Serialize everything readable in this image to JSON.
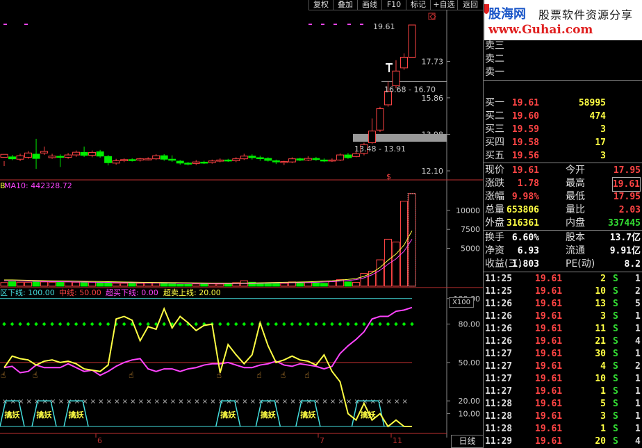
{
  "toolbar": {
    "b1": "复权",
    "b2": "叠加",
    "b3": "画线",
    "b4": "F10",
    "b5": "标记",
    "b6": "+自选",
    "b7": "返回"
  },
  "logo": {
    "brand": "股海网",
    "slogan": "股票软件资源分享",
    "url": "www.Guhai.com"
  },
  "chart_data": [
    {
      "type": "candlestick",
      "title": "",
      "ylim": [
        12.1,
        19.61
      ],
      "yticks": [
        12.1,
        13.98,
        15.86,
        17.73
      ],
      "annotations": [
        "19.61",
        "16.68 - 16.70",
        "13.48 - 13.91",
        "$"
      ],
      "candles": [
        [
          12.8,
          12.95,
          12.6,
          12.35
        ],
        [
          12.82,
          12.72,
          12.92,
          12.65
        ],
        [
          12.7,
          12.88,
          12.98,
          12.6
        ],
        [
          12.8,
          13.02,
          13.12,
          12.72
        ],
        [
          12.96,
          12.74,
          13.75,
          12.2
        ],
        [
          13.02,
          13.1,
          13.35,
          12.92
        ],
        [
          12.78,
          12.86,
          12.98,
          12.72
        ],
        [
          12.85,
          12.82,
          12.95,
          12.3
        ],
        [
          12.8,
          12.92,
          13.02,
          12.72
        ],
        [
          12.92,
          13.06,
          13.15,
          12.82
        ],
        [
          13.05,
          12.9,
          13.35,
          12.82
        ],
        [
          12.9,
          13.05,
          13.15,
          12.8
        ],
        [
          13.08,
          12.86,
          13.18,
          12.78
        ],
        [
          12.84,
          12.52,
          12.92,
          12.38
        ],
        [
          12.5,
          12.62,
          12.72,
          12.42
        ],
        [
          12.62,
          12.68,
          12.75,
          12.55
        ],
        [
          12.68,
          12.64,
          12.75,
          12.58
        ],
        [
          12.66,
          12.72,
          12.78,
          12.58
        ],
        [
          12.72,
          12.72,
          12.8,
          12.64
        ],
        [
          12.72,
          12.88,
          12.96,
          12.66
        ],
        [
          12.88,
          12.7,
          12.96,
          12.62
        ],
        [
          12.7,
          12.65,
          12.9,
          12.56
        ],
        [
          12.6,
          12.5,
          12.66,
          12.42
        ],
        [
          12.5,
          12.46,
          12.56,
          12.38
        ],
        [
          12.48,
          12.56,
          12.66,
          12.4
        ],
        [
          12.55,
          12.52,
          12.62,
          12.45
        ],
        [
          12.53,
          12.61,
          12.68,
          12.47
        ],
        [
          12.6,
          12.66,
          12.74,
          12.54
        ],
        [
          12.66,
          12.62,
          12.72,
          12.56
        ],
        [
          12.62,
          12.72,
          12.8,
          12.55
        ],
        [
          12.72,
          12.86,
          12.98,
          12.66
        ],
        [
          12.86,
          12.78,
          12.95,
          12.68
        ],
        [
          12.78,
          12.75,
          12.88,
          12.62
        ],
        [
          12.74,
          12.64,
          12.8,
          12.58
        ],
        [
          12.62,
          12.56,
          12.68,
          12.45
        ],
        [
          12.55,
          12.58,
          12.62,
          12.4
        ],
        [
          12.56,
          12.72,
          12.8,
          12.5
        ],
        [
          12.72,
          12.65,
          12.78,
          12.6
        ],
        [
          12.66,
          12.74,
          12.86,
          12.6
        ],
        [
          12.74,
          12.68,
          12.82,
          12.62
        ],
        [
          12.66,
          12.62,
          12.74,
          12.55
        ],
        [
          12.62,
          12.66,
          12.74,
          12.56
        ],
        [
          12.66,
          12.92,
          13.0,
          12.6
        ],
        [
          12.92,
          12.78,
          13.02,
          12.72
        ],
        [
          12.84,
          12.98,
          13.12,
          12.8
        ],
        [
          13.0,
          13.45,
          13.55,
          12.9
        ],
        [
          13.55,
          14.15,
          14.8,
          13.48
        ],
        [
          14.2,
          15.3,
          15.4,
          14.1
        ],
        [
          15.5,
          16.2,
          16.7,
          15.4
        ],
        [
          16.48,
          17.24,
          17.8,
          16.35
        ],
        [
          17.4,
          17.95,
          18.15,
          17.3
        ],
        [
          17.95,
          19.61,
          19.61,
          17.95
        ]
      ]
    },
    {
      "type": "bar",
      "title": "MA10: 442328.72",
      "ylim": [
        0,
        12200
      ],
      "yticks": [
        5000,
        7500,
        10000
      ],
      "unit": "X100",
      "values": [
        480,
        580,
        520,
        520,
        620,
        560,
        520,
        500,
        560,
        520,
        560,
        520,
        460,
        440,
        380,
        380,
        380,
        380,
        400,
        400,
        360,
        300,
        240,
        240,
        300,
        320,
        300,
        280,
        300,
        460,
        720,
        520,
        420,
        400,
        360,
        380,
        560,
        480,
        460,
        420,
        380,
        620,
        860,
        560,
        500,
        1700,
        1980,
        3480,
        6200,
        5840,
        11220,
        12220
      ],
      "ma10": [
        700,
        700,
        680,
        660,
        640,
        620,
        600,
        590,
        580,
        560,
        545,
        530,
        520,
        510,
        490,
        470,
        460,
        440,
        430,
        420,
        410,
        400,
        390,
        380,
        370,
        360,
        350,
        345,
        340,
        340,
        350,
        360,
        380,
        400,
        420,
        440,
        450,
        470,
        490,
        520,
        560,
        600,
        680,
        760,
        860,
        1100,
        1500,
        2100,
        2900,
        3600,
        4600,
        6200
      ]
    },
    {
      "type": "line",
      "title": "",
      "legend": [
        "区下线: 100.00",
        "中线: 50.00",
        "超买下线: 0.00",
        "超卖上线: 20.00"
      ],
      "ylim": [
        0,
        100
      ],
      "yticks": [
        10.0,
        20.0,
        50.0,
        80.0,
        100.0
      ],
      "hlines": [
        100,
        50,
        20
      ],
      "dotted_level": 80.0,
      "marker_label": "擒妖",
      "date_labels": [
        "6",
        "7",
        "11"
      ],
      "magenta": [
        46,
        47,
        42,
        43,
        48,
        46,
        46,
        46,
        49,
        46,
        43,
        44,
        40,
        43,
        47,
        50,
        52,
        53,
        45,
        43,
        45,
        45,
        43,
        45,
        46,
        48,
        49,
        49,
        50,
        48,
        46,
        46,
        48,
        49,
        51,
        48,
        47,
        49,
        48,
        47,
        45,
        47,
        57,
        63,
        68,
        74,
        84,
        86,
        86,
        90,
        91,
        93
      ],
      "yellow": [
        46,
        55,
        53,
        52,
        48,
        51,
        52,
        50,
        51,
        49,
        45,
        44,
        43,
        48,
        84,
        86,
        83,
        67,
        78,
        76,
        92,
        77,
        86,
        81,
        75,
        79,
        80,
        42,
        64,
        56,
        49,
        56,
        81,
        63,
        50,
        52,
        55,
        52,
        51,
        48,
        56,
        43,
        35,
        10,
        5,
        18,
        5,
        10,
        0,
        5,
        0,
        0
      ]
    }
  ],
  "quote": {
    "sell": [
      {
        "l": "卖五"
      },
      {
        "l": "卖四"
      },
      {
        "l": "卖三"
      },
      {
        "l": "卖二"
      },
      {
        "l": "卖一"
      }
    ],
    "buy": [
      {
        "l": "买一",
        "p": "19.61",
        "v": "58995"
      },
      {
        "l": "买二",
        "p": "19.60",
        "v": "474"
      },
      {
        "l": "买三",
        "p": "19.59",
        "v": "3"
      },
      {
        "l": "买四",
        "p": "19.58",
        "v": "17"
      },
      {
        "l": "买五",
        "p": "19.56",
        "v": "3"
      }
    ],
    "stats": [
      {
        "l": "现价",
        "a": "19.61",
        "l2": "今开",
        "b": "17.95"
      },
      {
        "l": "涨跌",
        "a": "1.78",
        "l2": "最高",
        "b": "19.61"
      },
      {
        "l": "涨幅",
        "a": "9.98%",
        "l2": "最低",
        "b": "17.95"
      },
      {
        "l": "总量",
        "a": "653806",
        "l2": "量比",
        "b": "2.03"
      },
      {
        "l": "外盘",
        "a": "316361",
        "l2": "内盘",
        "b": "337445"
      }
    ],
    "fin": [
      {
        "l": "换手",
        "a": "6.60%",
        "l2": "股本",
        "b": "13.7亿"
      },
      {
        "l": "净资",
        "a": "6.93",
        "l2": "流通",
        "b": "9.91亿"
      },
      {
        "l": "收益(三)",
        "a": "1.803",
        "l2": "PE(动)",
        "b": "8.2"
      }
    ]
  },
  "ticks": [
    {
      "t": "11:25",
      "p": "19.61",
      "v": "2",
      "s": "S",
      "n": "1"
    },
    {
      "t": "11:25",
      "p": "19.61",
      "v": "10",
      "s": "S",
      "n": "2"
    },
    {
      "t": "11:26",
      "p": "19.61",
      "v": "13",
      "s": "S",
      "n": "5"
    },
    {
      "t": "11:26",
      "p": "19.61",
      "v": "3",
      "s": "S",
      "n": "1"
    },
    {
      "t": "11:26",
      "p": "19.61",
      "v": "11",
      "s": "S",
      "n": "1"
    },
    {
      "t": "11:26",
      "p": "19.61",
      "v": "21",
      "s": "S",
      "n": "4"
    },
    {
      "t": "11:27",
      "p": "19.61",
      "v": "30",
      "s": "S",
      "n": "1"
    },
    {
      "t": "11:27",
      "p": "19.61",
      "v": "4",
      "s": "S",
      "n": "2"
    },
    {
      "t": "11:27",
      "p": "19.61",
      "v": "10",
      "s": "S",
      "n": "1"
    },
    {
      "t": "11:27",
      "p": "19.61",
      "v": "1",
      "s": "S",
      "n": "1"
    },
    {
      "t": "11:28",
      "p": "19.61",
      "v": "5",
      "s": "S",
      "n": "1"
    },
    {
      "t": "11:28",
      "p": "19.61",
      "v": "3",
      "s": "S",
      "n": "1"
    },
    {
      "t": "11:28",
      "p": "19.61",
      "v": "1",
      "s": "S",
      "n": "1"
    },
    {
      "t": "11:29",
      "p": "19.61",
      "v": "20",
      "s": "S",
      "n": "4"
    }
  ],
  "period": "日线",
  "colors": {
    "up": "#ff4444",
    "down": "#00ee00",
    "magenta": "#ff44ff",
    "yellow": "#ffff44",
    "cyan": "#44dddd"
  }
}
